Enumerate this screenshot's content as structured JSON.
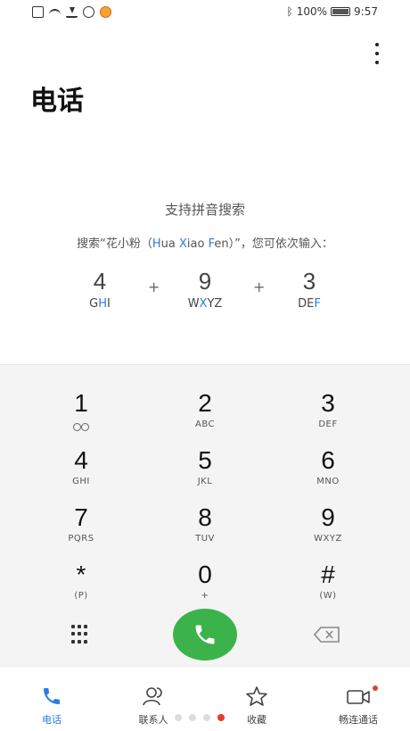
{
  "status_bar": {
    "battery": "100%",
    "time": "9:57",
    "icons": [
      "notification-icon",
      "wifi-icon",
      "download-icon",
      "x-app-icon",
      "weibo-icon",
      "bluetooth-icon",
      "battery-icon"
    ]
  },
  "header": {
    "title": "电话",
    "more_icon": "more-vertical-icon"
  },
  "hint": {
    "title": "支持拼音搜索",
    "desc_prefix": "搜索“花小粉（",
    "desc_h": "H",
    "desc_ua": "ua ",
    "desc_x": "X",
    "desc_iao": "iao ",
    "desc_f": "F",
    "desc_en": "en",
    "desc_suffix": "）”，您可依次输入：",
    "keys": [
      {
        "num": "4",
        "letters_hi": "G",
        "letters_rest": "HI",
        "hl_first": false,
        "display": "GHI",
        "highlight": "H"
      },
      {
        "num": "9",
        "display": "WXYZ",
        "highlight": "X"
      },
      {
        "num": "3",
        "display": "DEF",
        "highlight": "F"
      }
    ],
    "plus": "+"
  },
  "keypad": {
    "keys": [
      {
        "num": "1",
        "sub": ""
      },
      {
        "num": "2",
        "sub": "ABC"
      },
      {
        "num": "3",
        "sub": "DEF"
      },
      {
        "num": "4",
        "sub": "GHI"
      },
      {
        "num": "5",
        "sub": "JKL"
      },
      {
        "num": "6",
        "sub": "MNO"
      },
      {
        "num": "7",
        "sub": "PQRS"
      },
      {
        "num": "8",
        "sub": "TUV"
      },
      {
        "num": "9",
        "sub": "WXYZ"
      },
      {
        "num": "*",
        "sub": "(P)"
      },
      {
        "num": "0",
        "sub": "+"
      },
      {
        "num": "#",
        "sub": "(W)"
      }
    ]
  },
  "nav": {
    "items": [
      {
        "label": "电话",
        "icon": "phone-icon"
      },
      {
        "label": "联系人",
        "icon": "contacts-icon"
      },
      {
        "label": "收藏",
        "icon": "star-icon"
      },
      {
        "label": "畅连通话",
        "icon": "video-call-icon"
      }
    ]
  },
  "colors": {
    "accent": "#2a7be4",
    "call_green": "#3cb24a",
    "badge_red": "#e0402a"
  }
}
